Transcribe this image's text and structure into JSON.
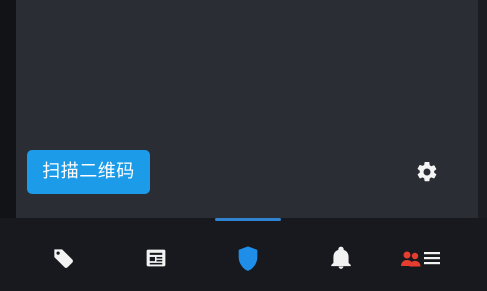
{
  "scan_button": {
    "label": "扫描二维码"
  },
  "icons": {
    "settings": "gear-icon",
    "tabs": [
      "tag-icon",
      "news-icon",
      "shield-icon",
      "bell-icon",
      "user-list-icon"
    ]
  },
  "colors": {
    "accent_blue": "#1c9be9",
    "active_tab": "#1e8ee8",
    "inactive_tab": "#f2f2f2",
    "users_icon": "#e53d2f",
    "content_bg": "#2a2d33",
    "nav_bg": "#17191e"
  },
  "bottom_nav": {
    "active_index": 2
  }
}
